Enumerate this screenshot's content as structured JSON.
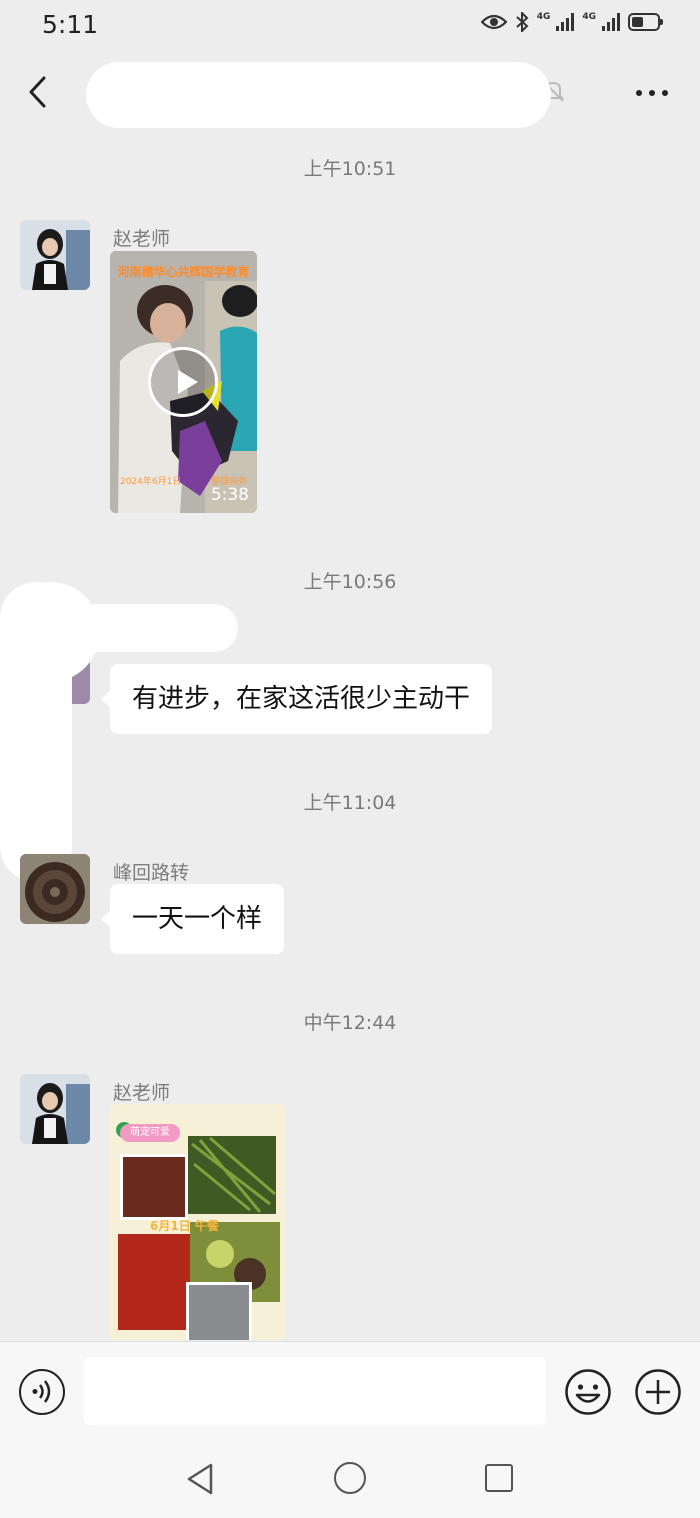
{
  "status_bar": {
    "time": "5:11",
    "net_1": "4G",
    "net_2": "4G",
    "battery_level": 0.45
  },
  "header": {
    "title": "",
    "back_icon": "chevron-left-icon",
    "more_icon": "more-dots-icon"
  },
  "messages": [
    {
      "type": "timestamp",
      "text": "上午10:51"
    },
    {
      "type": "video",
      "sender": "赵老师",
      "caption": "河南穗华心共辉国学教育",
      "date": "2024年6月1日",
      "note": "整理内务",
      "duration": "5:38"
    },
    {
      "type": "timestamp",
      "text": "上午10:56"
    },
    {
      "type": "text",
      "sender": "",
      "text": "有进步，在家这活很少主动干"
    },
    {
      "type": "timestamp",
      "text": "上午11:04"
    },
    {
      "type": "text",
      "sender": "峰回路转",
      "text": "一天一个样"
    },
    {
      "type": "timestamp",
      "text": "中午12:44"
    },
    {
      "type": "image",
      "sender": "赵老师",
      "tag": "萌宠可爱",
      "label": "6月1日 午餐"
    }
  ],
  "input_bar": {
    "placeholder": "",
    "voice_icon": "voice-icon",
    "emoji_icon": "emoji-icon",
    "plus_icon": "plus-icon"
  },
  "system_nav": {
    "back": "nav-back-icon",
    "home": "nav-home-icon",
    "recent": "nav-recent-icon"
  },
  "colors": {
    "background": "#ededed",
    "bubble": "#ffffff",
    "timestamp": "#7a7a7a"
  }
}
